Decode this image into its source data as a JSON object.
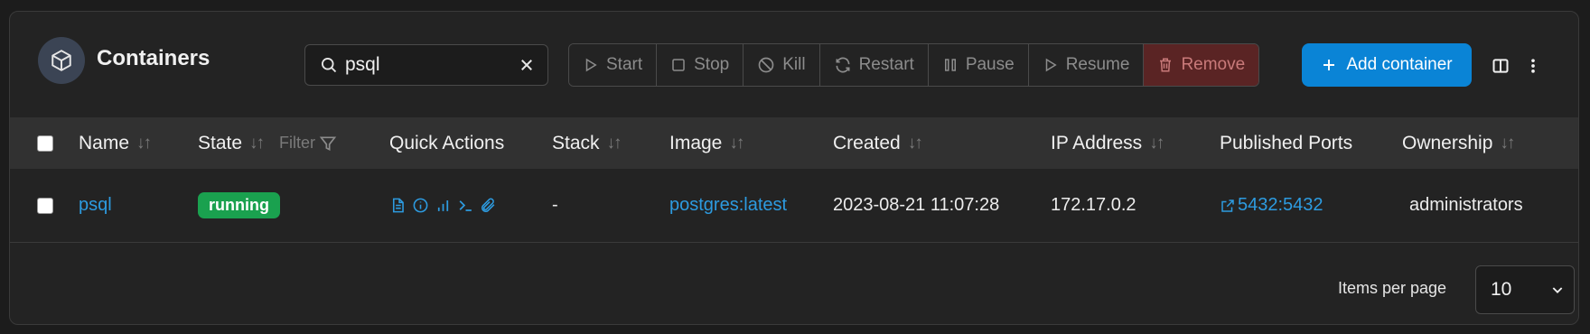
{
  "header": {
    "title": "Containers",
    "search_value": "psql",
    "actions": [
      {
        "label": "Start",
        "icon": "play-icon"
      },
      {
        "label": "Stop",
        "icon": "square-icon"
      },
      {
        "label": "Kill",
        "icon": "ban-icon"
      },
      {
        "label": "Restart",
        "icon": "refresh-icon"
      },
      {
        "label": "Pause",
        "icon": "pause-icon"
      },
      {
        "label": "Resume",
        "icon": "play-icon"
      },
      {
        "label": "Remove",
        "icon": "trash-icon"
      }
    ],
    "add_label": "Add container"
  },
  "table": {
    "columns": {
      "name": "Name",
      "state": "State",
      "state_filter": "Filter",
      "quick_actions": "Quick Actions",
      "stack": "Stack",
      "image": "Image",
      "created": "Created",
      "ip": "IP Address",
      "ports": "Published Ports",
      "ownership": "Ownership"
    },
    "sort_glyph": "↓↑",
    "rows": [
      {
        "name": "psql",
        "state": "running",
        "stack": "-",
        "image": "postgres:latest",
        "created": "2023-08-21 11:07:28",
        "ip": "172.17.0.2",
        "ports": "5432:5432",
        "ownership": "administrators"
      }
    ]
  },
  "footer": {
    "items_per_page_label": "Items per page",
    "items_per_page_value": "10"
  },
  "colors": {
    "accent": "#0a84d6",
    "link": "#2d9be0",
    "running": "#1aa14f",
    "remove_bg": "#5a2424"
  }
}
